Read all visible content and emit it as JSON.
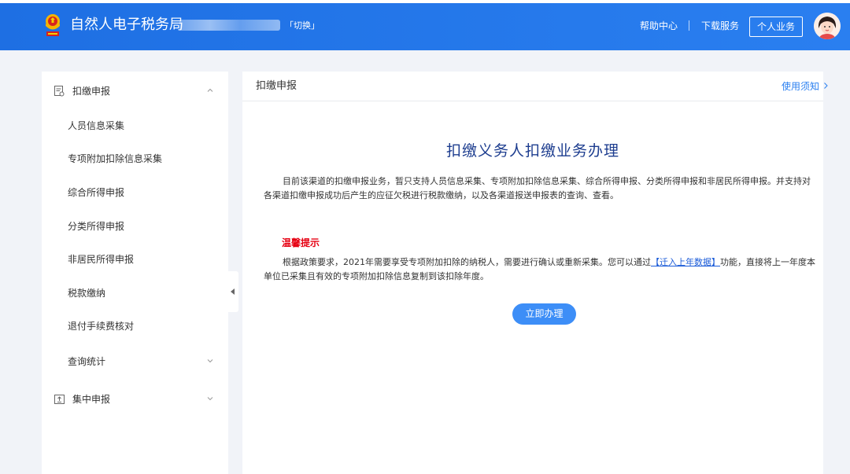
{
  "header": {
    "app_title": "自然人电子税务局",
    "switch_label": "「切换」",
    "help_center": "帮助中心",
    "download_service": "下载服务",
    "personal_business": "个人业务"
  },
  "sidebar": {
    "groups": [
      {
        "label": "扣缴申报",
        "icon": "report-form-icon",
        "expanded": true,
        "items": [
          {
            "label": "人员信息采集"
          },
          {
            "label": "专项附加扣除信息采集"
          },
          {
            "label": "综合所得申报"
          },
          {
            "label": "分类所得申报"
          },
          {
            "label": "非居民所得申报"
          },
          {
            "label": "税款缴纳"
          },
          {
            "label": "退付手续费核对"
          },
          {
            "label": "查询统计"
          }
        ]
      },
      {
        "label": "集中申报",
        "icon": "central-report-icon",
        "expanded": false
      }
    ]
  },
  "main": {
    "title": "扣缴申报",
    "notice_link": "使用须知",
    "headline": "扣缴义务人扣缴业务办理",
    "intro": "目前该渠道的扣缴申报业务，暂只支持人员信息采集、专项附加扣除信息采集、综合所得申报、分类所得申报和非居民所得申报。并支持对各渠道扣缴申报成功后产生的应征欠税进行税款缴纳，以及各渠道报送申报表的查询、查看。",
    "tip_title": "温馨提示",
    "tip_before": "根据政策要求，2021年需要享受专项附加扣除的纳税人，需要进行确认或重新采集。您可以通过",
    "tip_link": "【迁入上年数据】",
    "tip_after": "功能，直接将上一年度本单位已采集且有效的专项附加扣除信息复制到该扣除年度。",
    "action_button": "立即办理"
  },
  "colors": {
    "brand": "#1e6fe3",
    "headline": "#1d3d8f",
    "warning": "#e60012",
    "button": "#3d8ef7",
    "link": "#1a5bd8"
  }
}
